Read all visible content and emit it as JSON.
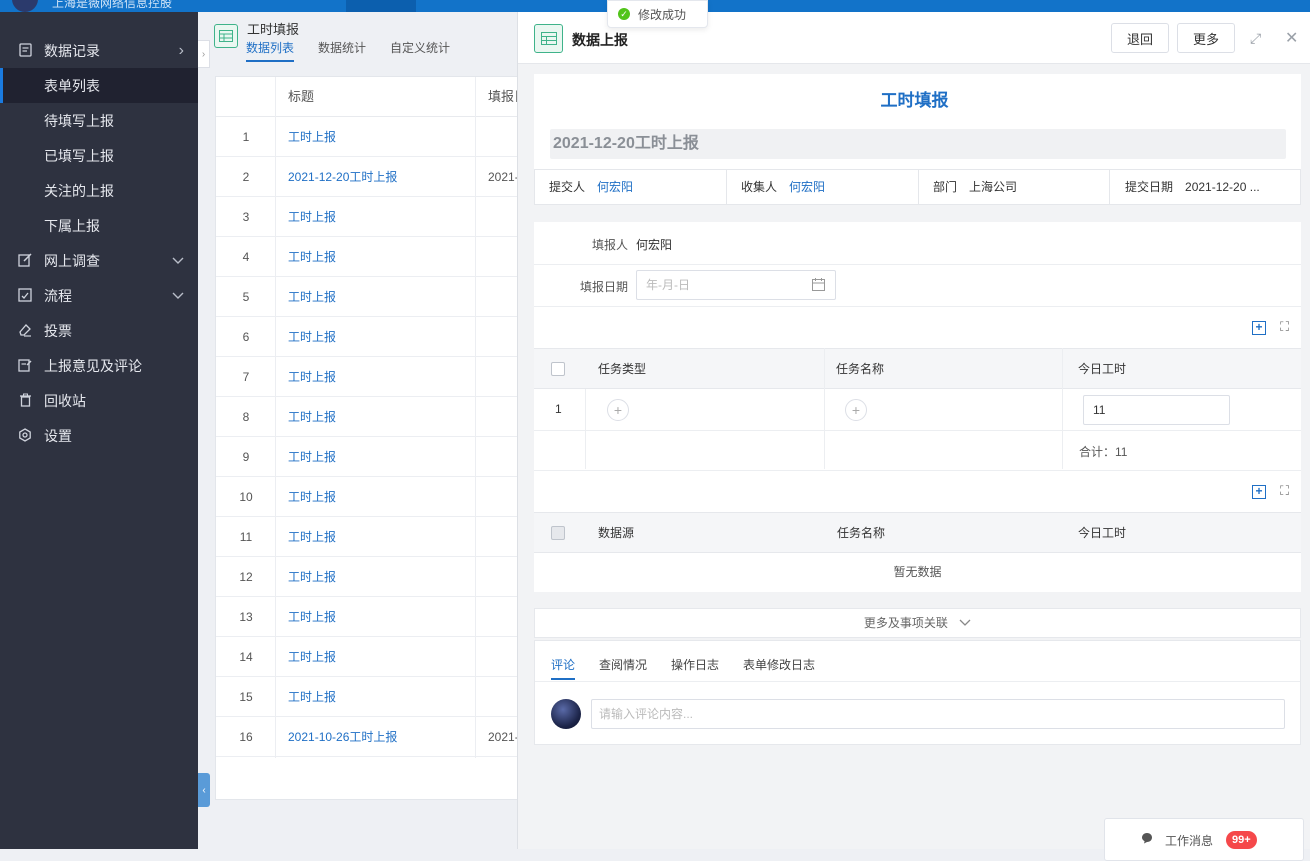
{
  "topbar": {
    "app_title": "上海是薇网络信息控股"
  },
  "toast": {
    "text": "修改成功"
  },
  "sidebar": {
    "items": [
      {
        "label": "数据记录",
        "icon": "document-icon",
        "arrow": "›"
      },
      {
        "label": "表单列表"
      },
      {
        "label": "待填写上报"
      },
      {
        "label": "已填写上报"
      },
      {
        "label": "关注的上报"
      },
      {
        "label": "下属上报"
      },
      {
        "label": "网上调查",
        "icon": "edit-icon",
        "arrow": "⌄"
      },
      {
        "label": "流程",
        "icon": "flow-icon",
        "arrow": "⌄"
      },
      {
        "label": "投票",
        "icon": "eraser-icon"
      },
      {
        "label": "上报意见及评论",
        "icon": "comment-edit-icon"
      },
      {
        "label": "回收站",
        "icon": "trash-icon"
      },
      {
        "label": "设置",
        "icon": "settings-icon"
      }
    ]
  },
  "list": {
    "form_title": "工时填报",
    "tabs": [
      "数据列表",
      "数据统计",
      "自定义统计"
    ],
    "columns": [
      "标题",
      "填报日"
    ],
    "rows": [
      {
        "n": "1",
        "title": "工时上报",
        "date": ""
      },
      {
        "n": "2",
        "title": "2021-12-20工时上报",
        "date": "2021-"
      },
      {
        "n": "3",
        "title": "工时上报",
        "date": ""
      },
      {
        "n": "4",
        "title": "工时上报",
        "date": ""
      },
      {
        "n": "5",
        "title": "工时上报",
        "date": ""
      },
      {
        "n": "6",
        "title": "工时上报",
        "date": ""
      },
      {
        "n": "7",
        "title": "工时上报",
        "date": ""
      },
      {
        "n": "8",
        "title": "工时上报",
        "date": ""
      },
      {
        "n": "9",
        "title": "工时上报",
        "date": ""
      },
      {
        "n": "10",
        "title": "工时上报",
        "date": ""
      },
      {
        "n": "11",
        "title": "工时上报",
        "date": ""
      },
      {
        "n": "12",
        "title": "工时上报",
        "date": ""
      },
      {
        "n": "13",
        "title": "工时上报",
        "date": ""
      },
      {
        "n": "14",
        "title": "工时上报",
        "date": ""
      },
      {
        "n": "15",
        "title": "工时上报",
        "date": ""
      },
      {
        "n": "16",
        "title": "2021-10-26工时上报",
        "date": "2021-"
      }
    ]
  },
  "detail": {
    "header_title": "数据上报",
    "btn_return": "退回",
    "btn_more": "更多",
    "form_name": "工时填报",
    "record_title": "2021-12-20工时上报",
    "meta": {
      "submitter_label": "提交人",
      "submitter": "何宏阳",
      "collector_label": "收集人",
      "collector": "何宏阳",
      "dept_label": "部门",
      "dept": "上海公司",
      "date_label": "提交日期",
      "date": "2021-12-20 ..."
    },
    "filler_label": "填报人",
    "filler": "何宏阳",
    "fill_date_label": "填报日期",
    "fill_date_placeholder": "年-月-日",
    "table1": {
      "headers": [
        "任务类型",
        "任务名称",
        "今日工时"
      ],
      "row_no": "1",
      "hours": "11",
      "total": "合计：11"
    },
    "table2": {
      "headers": [
        "数据源",
        "任务名称",
        "今日工时"
      ],
      "empty": "暂无数据"
    },
    "more_link": "更多及事项关联",
    "tabs": [
      "评论",
      "查阅情况",
      "操作日志",
      "表单修改日志"
    ],
    "comment_placeholder": "请输入评论内容..."
  },
  "messages": {
    "label": "工作消息",
    "badge": "99+"
  }
}
